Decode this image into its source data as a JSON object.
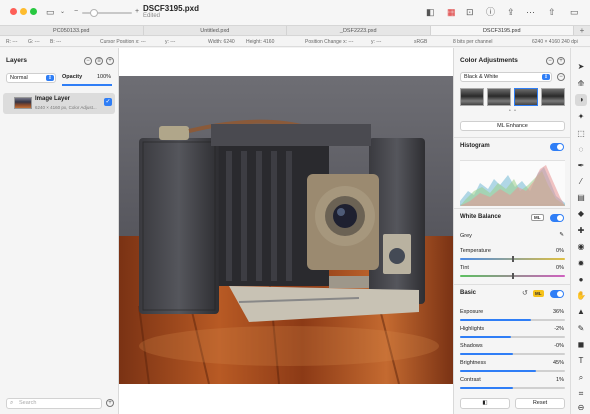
{
  "window": {
    "title": "DSCF3195.pxd",
    "subtitle": "Edited"
  },
  "tabs": [
    {
      "label": "PC050133.pxd",
      "active": false
    },
    {
      "label": "Untitled.pxd",
      "active": false
    },
    {
      "label": "_DSF2223.pxd",
      "active": false
    },
    {
      "label": "DSCF3195.pxd",
      "active": true
    }
  ],
  "infobar": {
    "r": "R: ---",
    "g": "G: ---",
    "b": "B: ---",
    "cursor_x": "Cursor Position x: ---",
    "cursor_y": "y: ---",
    "width": "Width: 6240",
    "height": "Height: 4160",
    "pos_x": "Position Change x: ---",
    "pos_y": "y: ---",
    "colorspace": "sRGB",
    "bits": "8 bits per channel",
    "dims": "6240 × 4160 240 dpi"
  },
  "layers": {
    "title": "Layers",
    "blend_mode": "Normal",
    "opacity_label": "Opacity",
    "opacity_value": "100%",
    "items": [
      {
        "name": "Image Layer",
        "info": "6240 × 4160 px, Color Adjust...",
        "visible": true
      }
    ],
    "search_placeholder": "Search"
  },
  "adjustments": {
    "title": "Color Adjustments",
    "preset": "Black & White",
    "ml_enhance": "ML Enhance",
    "histogram_label": "Histogram",
    "white_balance": {
      "label": "White Balance",
      "badge": "ML",
      "grey_label": "Grey",
      "temperature": {
        "label": "Temperature",
        "value": "0%"
      },
      "tint": {
        "label": "Tint",
        "value": "0%"
      }
    },
    "basic": {
      "label": "Basic",
      "badge": "ML",
      "rows": [
        {
          "label": "Exposure",
          "value": "36%",
          "level": 0.68
        },
        {
          "label": "Highlights",
          "value": "-2%",
          "level": 0.49
        },
        {
          "label": "Shadows",
          "value": "-0%",
          "level": 0.5
        },
        {
          "label": "Brightness",
          "value": "45%",
          "level": 0.72
        },
        {
          "label": "Contrast",
          "value": "1%",
          "level": 0.505
        }
      ]
    },
    "reset_label": "Reset"
  },
  "colors": {
    "accent": "#2f7ef6",
    "ml_badge": "#f6c21a"
  }
}
